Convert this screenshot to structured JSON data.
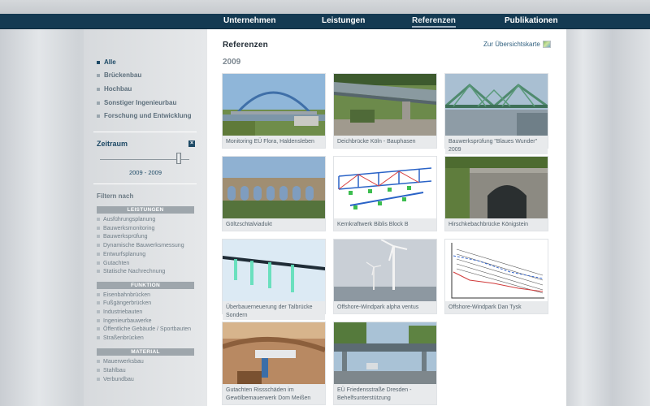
{
  "nav": {
    "items": [
      {
        "label": "Unternehmen"
      },
      {
        "label": "Leistungen"
      },
      {
        "label": "Referenzen"
      },
      {
        "label": "Publikationen"
      }
    ]
  },
  "sidebar": {
    "categories": [
      {
        "label": "Alle"
      },
      {
        "label": "Brückenbau"
      },
      {
        "label": "Hochbau"
      },
      {
        "label": "Sonstiger Ingenieurbau"
      },
      {
        "label": "Forschung und Entwicklung"
      }
    ],
    "zeitraum": {
      "title": "Zeitraum",
      "close_label": "×",
      "range": "2009 - 2009"
    },
    "filter_title": "Filtern nach",
    "groups": [
      {
        "title": "LEISTUNGEN",
        "items": [
          "Ausführungsplanung",
          "Bauwerksmonitoring",
          "Bauwerksprüfung",
          "Dynamische Bauwerksmessung",
          "Entwurfsplanung",
          "Gutachten",
          "Statische Nachrechnung"
        ]
      },
      {
        "title": "FUNKTION",
        "items": [
          "Eisenbahnbrücken",
          "Fußgängerbrücken",
          "Industriebauten",
          "Ingenieurbauwerke",
          "Öffentliche Gebäude / Sportbauten",
          "Straßenbrücken"
        ]
      },
      {
        "title": "MATERIAL",
        "items": [
          "Mauerwerksbau",
          "Stahlbau",
          "Verbundbau"
        ]
      }
    ]
  },
  "main": {
    "title": "Referenzen",
    "map_link": "Zur Übersichtskarte",
    "year": "2009",
    "cards": [
      {
        "caption": "Monitoring EÜ Flora, Haldensleben",
        "icon": "arch-bridge-photo"
      },
      {
        "caption": "Deichbrücke Köln - Bauphasen",
        "icon": "bridge-underside-photo"
      },
      {
        "caption": "Bauwerksprüfung \"Blaues Wunder\" 2009",
        "icon": "truss-bridge-photo"
      },
      {
        "caption": "Göltzschtalviadukt",
        "icon": "viaduct-photo"
      },
      {
        "caption": "Kernkraftwerk Biblis Block B",
        "icon": "truss-model-render"
      },
      {
        "caption": "Hirschkebachbrücke Königstein",
        "icon": "stone-arch-photo"
      },
      {
        "caption": "Überbauerneuerung der Talbrücke Sondern",
        "icon": "bridge-model-render"
      },
      {
        "caption": "Offshore-Windpark alpha ventus",
        "icon": "wind-turbines-photo"
      },
      {
        "caption": "Offshore-Windpark Dan Tysk",
        "icon": "analysis-chart-image"
      },
      {
        "caption": "Gutachten Rissschäden im Gewölbemauerwerk Dom Meißen",
        "icon": "masonry-damage-photo"
      },
      {
        "caption": "EÜ Friedensstraße Dresden - Behelfsunterstützung",
        "icon": "railway-underpass-photo"
      }
    ]
  }
}
